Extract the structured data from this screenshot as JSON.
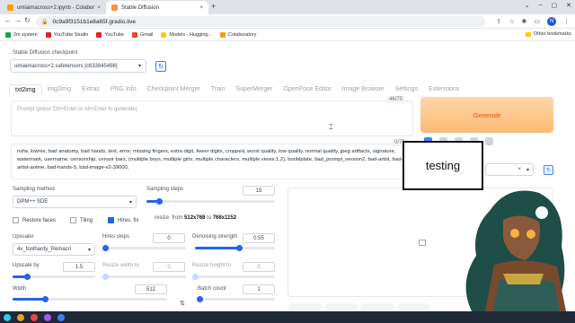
{
  "browser": {
    "tabs": [
      {
        "label": "umiaimacross+2.ipynb - Colabor",
        "close": "×"
      },
      {
        "label": "Stable Diffusion",
        "close": "×"
      }
    ],
    "new_tab": "+",
    "url": "0c9a9f3151b1e8a65f.gradio.live",
    "profile_initial": "N",
    "bookmarks": [
      "2m system",
      "YouTube Studio",
      "YouTube",
      "Gmail",
      "Models - Hugging...",
      "Colaboratory"
    ],
    "other_bookmarks": "Other bookmarks"
  },
  "checkpoint": {
    "label": "Stable Diffusion checkpoint",
    "value": "umiaimacross+2.safetensors [c633845498]"
  },
  "tabs": [
    "txt2img",
    "img2img",
    "Extras",
    "PNG Info",
    "Checkpoint Merger",
    "Train",
    "SuperMerger",
    "OpenPose Editor",
    "Image Browser",
    "Settings",
    "Extensions"
  ],
  "prompt": {
    "placeholder": "Prompt (press Ctrl+Enter or Alt+Enter to generate)",
    "counter": "46/75"
  },
  "negative": {
    "text": "nsfw, lowres, bad anatomy, bad hands, text, error, missing fingers, extra digit, fewer digits, cropped, worst quality, low quality, normal quality, jpeg artifacts, signature, watermark, username, censorship, censor bars, (multiple boys, multiple girls, multiple characters, multiple views:1.2), booblplate, bad_prompt_version2, bad-artist, bad-artist-anime, bad-hands-5, bad-image-v2-39000,",
    "counter": "0/75"
  },
  "generate_label": "Generate",
  "sampling": {
    "method_label": "Sampling method",
    "method_value": "DPM++ SDE",
    "steps_label": "Sampling steps",
    "steps_value": "15",
    "steps_fraction": 0.1
  },
  "checks": {
    "restore_faces": "Restore faces",
    "tiling": "Tiling",
    "hires_fix": "Hires. fix"
  },
  "resize": {
    "prefix": "resize: from ",
    "from": "512x768",
    "mid": " to ",
    "to": "768x1152"
  },
  "hires": {
    "upscaler_label": "Upscaler",
    "upscaler_value": "4x_foolhardy_Remacri",
    "steps_label": "Hires steps",
    "steps_value": "0",
    "steps_fraction": 0.0,
    "denoise_label": "Denoising strength",
    "denoise_value": "0.55",
    "denoise_fraction": 0.55,
    "upscale_by_label": "Upscale by",
    "upscale_by_value": "1.5",
    "upscale_by_fraction": 0.17,
    "resize_w_label": "Resize width to",
    "resize_w_value": "0",
    "resize_h_label": "Resize height to",
    "resize_h_value": "0"
  },
  "size": {
    "width_label": "Width",
    "width_value": "512",
    "width_fraction": 0.21,
    "batch_count_label": "Batch count",
    "batch_count_value": "1",
    "batch_count_fraction": 0.0
  },
  "swap_icon": "⇅",
  "bubble_text": "testing",
  "colors": {
    "accent": "#2563eb",
    "generate": "#fdba74",
    "generate_text": "#ea580c"
  }
}
